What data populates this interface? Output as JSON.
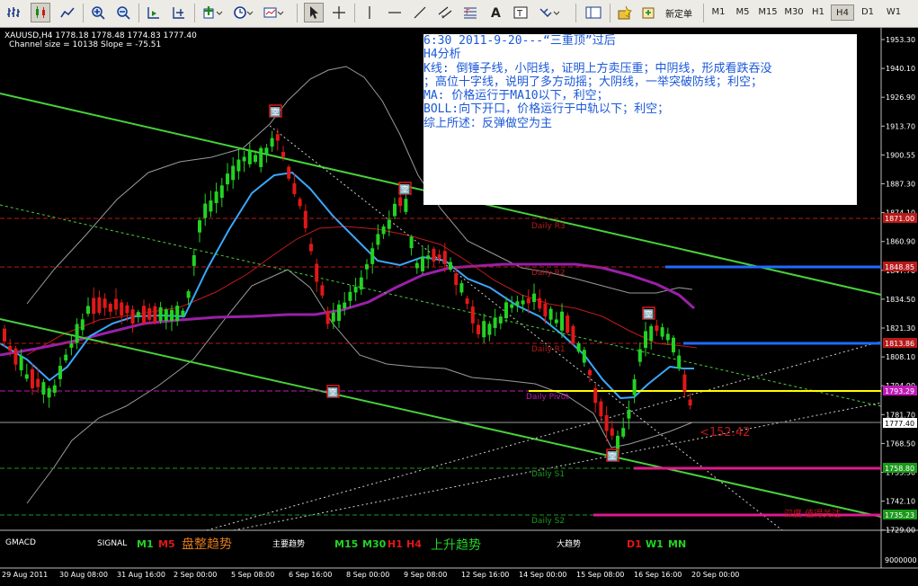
{
  "toolbar": {
    "new_order_label": "新定单",
    "timeframes": [
      "M1",
      "M5",
      "M15",
      "M30",
      "H1",
      "H4",
      "D1",
      "W1"
    ],
    "active_timeframe": "H4"
  },
  "chart_header": {
    "line1": "XAUUSD,H4  1778.18 1778.48 1774.83 1777.40",
    "line2": "Channel size = 10138 Slope = -75.51"
  },
  "annotation": {
    "lines": [
      "6:30 2011-9-20---“三重顶”过后",
      "H4分析",
      "K线: 倒锤子线，小阳线，证明上方卖压重；中阴线，形成看跌吞没",
      "；高位十字线，说明了多方动摇；大阴线，一举突破防线；利空；",
      "MA: 价格运行于MA10以下，利空；",
      "BOLL:向下开口，价格运行于中轨以下；利空；",
      "综上所述：反弹做空为主"
    ]
  },
  "pivot_labels": {
    "r3": "Daily R3",
    "r2": "Daily R2",
    "r1": "Daily R1",
    "pivot": "Daily Pivot",
    "s1": "Daily S1",
    "s2": "Daily S2"
  },
  "price_tags": {
    "r3": "1871.00",
    "r2": "1848.85",
    "r1": "1813.86",
    "pivot": "1793.29",
    "current": "1777.40",
    "s1": "1758.80",
    "s2": "1735.23"
  },
  "counter_text": "<152.42",
  "lower_right_label": "深度  值得关注",
  "price_axis": [
    "1953.30",
    "1940.10",
    "1926.90",
    "1913.70",
    "1900.55",
    "1887.30",
    "1874.10",
    "1860.90",
    "1847.70",
    "1834.50",
    "1821.30",
    "1808.10",
    "1794.90",
    "1781.70",
    "1768.50",
    "1755.30",
    "1742.10",
    "1729.00"
  ],
  "indicator_panel": {
    "name": "GMACD",
    "signal_label": "SIGNAL",
    "m1": "M1",
    "m5": "M5",
    "consolidation": "盘整趋势",
    "main_trend": "主要趋势",
    "m15": "M15",
    "m30": "M30",
    "h1": "H1",
    "h4": "H4",
    "uptrend": "上升趋势",
    "major_trend": "大趋势",
    "d1": "D1",
    "w1": "W1",
    "mn": "MN",
    "axis_value": "9000000"
  },
  "time_axis": [
    "29 Aug 2011",
    "30 Aug 08:00",
    "31 Aug 16:00",
    "2 Sep 00:00",
    "5 Sep 08:00",
    "6 Sep 16:00",
    "8 Sep 00:00",
    "9 Sep 08:00",
    "12 Sep 16:00",
    "14 Sep 00:00",
    "15 Sep 08:00",
    "16 Sep 16:00",
    "20 Sep 00:00"
  ],
  "pattern_marker": "🈳",
  "colors": {
    "bull": "#22d322",
    "bear": "#e01818",
    "ma_blue": "#3aa8ff",
    "ma_purple": "#9a20a8",
    "channel": "#47d13a",
    "pivot_yellow": "#ffff00",
    "support_magenta": "#e01a8c",
    "resistance_blue": "#1e6cff"
  }
}
